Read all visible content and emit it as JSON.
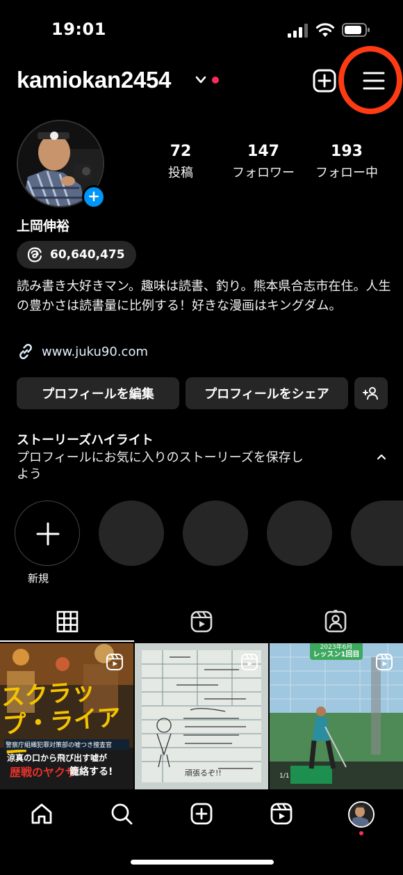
{
  "status": {
    "time": "19:01"
  },
  "header": {
    "username": "kamiokan2454"
  },
  "profile": {
    "name": "上岡伸裕",
    "threads_count": "60,640,475",
    "bio": "読み書き大好きマン。趣味は読書、釣り。熊本県合志市在住。人生の豊かさは読書量に比例する！好きな漫画はキングダム。",
    "link": "www.juku90.com",
    "stats": [
      {
        "num": "72",
        "label": "投稿"
      },
      {
        "num": "147",
        "label": "フォロワー"
      },
      {
        "num": "193",
        "label": "フォロー中"
      }
    ]
  },
  "buttons": {
    "edit": "プロフィールを編集",
    "share": "プロフィールをシェア"
  },
  "highlights": {
    "title": "ストーリーズハイライト",
    "subtitle": "プロフィールにお気に入りのストーリーズを保存しよう",
    "new_label": "新規"
  },
  "grid": {
    "posts": [
      {
        "type": "book-cover",
        "title": "スクラップ・ライアー",
        "lines": [
          "警察庁組織犯罪対策部の嘘つき捜査官",
          "涼真の口から飛び出す嘘が",
          "歴戦のヤクザ",
          "籠絡する!"
        ]
      },
      {
        "type": "handwritten-notes",
        "lines": [
          "頑張るぞ!!"
        ]
      },
      {
        "type": "golf-photo",
        "badge": [
          "2023年6月",
          "レッスン1回目"
        ],
        "counter": "1/1"
      }
    ]
  },
  "icons": {
    "add": "plus-square-icon",
    "menu": "hamburger-menu-icon",
    "tabs": [
      "grid-icon",
      "reels-icon",
      "tagged-icon"
    ],
    "nav": [
      "home-icon",
      "search-icon",
      "create-icon",
      "reels-icon",
      "profile-avatar"
    ]
  },
  "colors": {
    "accent": "#0095f6",
    "annotation": "#ff3b14",
    "notification": "#ff2d55"
  }
}
